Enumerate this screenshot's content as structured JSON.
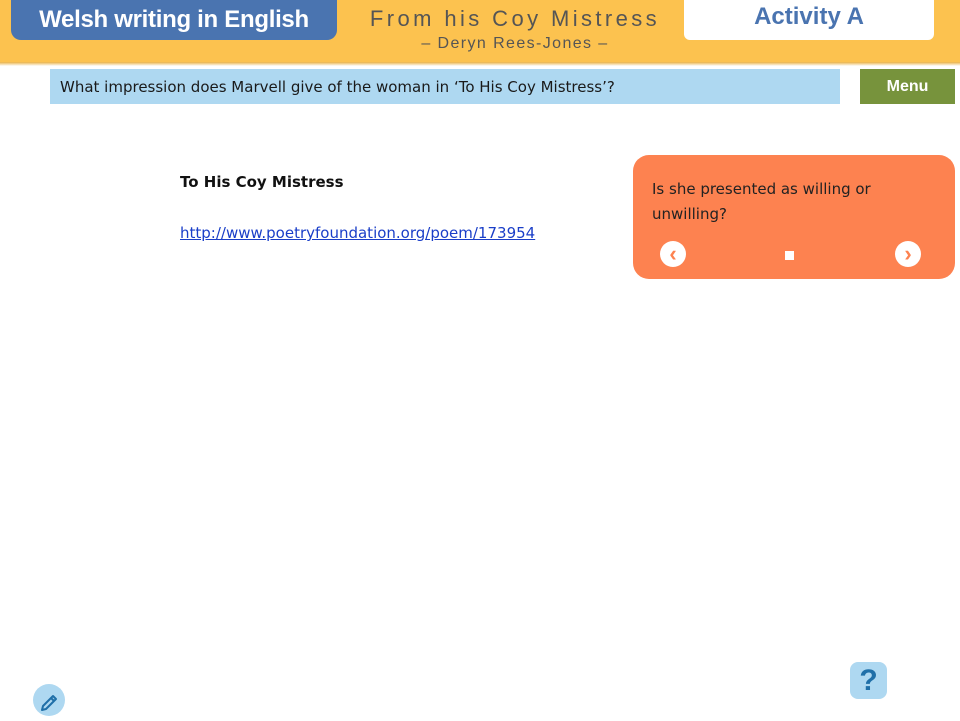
{
  "header": {
    "brand": "Welsh writing in English",
    "poem_title": "From his Coy Mistress",
    "poem_author": "– Deryn Rees-Jones –",
    "activity": "Activity A"
  },
  "question": {
    "text": "What impression does Marvell give of the woman in ‘To His Coy Mistress’?",
    "menu_label": "Menu"
  },
  "poem_reference": {
    "heading": "To His Coy Mistress",
    "link_text": "http://www.poetryfoundation.org/poem/173954"
  },
  "prompt_card": {
    "text": "Is she presented as willing or unwilling?",
    "prev_icon": "chevron-left-icon",
    "next_icon": "chevron-right-icon"
  },
  "footer": {
    "pencil_icon": "pencil-icon",
    "help_icon": "help-icon",
    "help_glyph": "?"
  },
  "colors": {
    "banner": "#fcc24f",
    "brand_pill": "#4a74b0",
    "question_bar": "#aed8f1",
    "menu_button": "#77933c",
    "prompt_card": "#fd8250",
    "link": "#1a3ec8"
  }
}
